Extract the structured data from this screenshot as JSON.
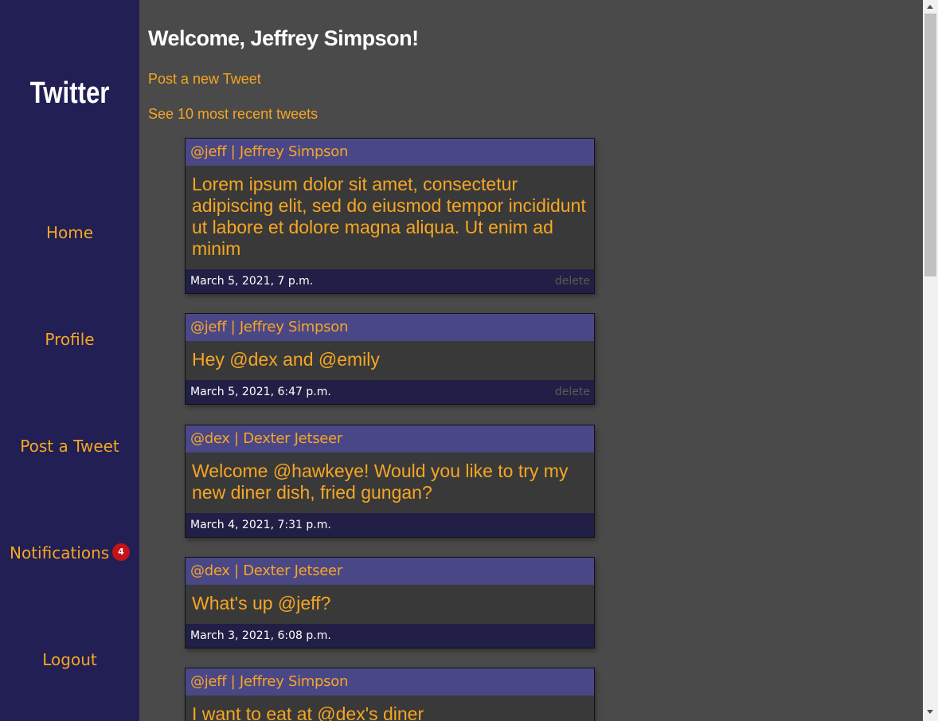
{
  "sidebar": {
    "brand": "Twitter",
    "items": [
      {
        "label": "Home"
      },
      {
        "label": "Profile"
      },
      {
        "label": "Post a Tweet"
      },
      {
        "label": "Notifications",
        "badge": "4"
      },
      {
        "label": "Logout"
      }
    ]
  },
  "main": {
    "welcome": "Welcome, Jeffrey Simpson!",
    "post_link": "Post a new Tweet",
    "recent_link": "See 10 most recent tweets"
  },
  "tweets": [
    {
      "header": "@jeff | Jeffrey Simpson",
      "body": "Lorem ipsum dolor sit amet, consectetur adipiscing elit, sed do eiusmod tempor incididunt ut labore et dolore magna aliqua. Ut enim ad minim",
      "date": "March 5, 2021, 7 p.m.",
      "delete": "delete"
    },
    {
      "header": "@jeff | Jeffrey Simpson",
      "body": "Hey @dex and @emily",
      "date": "March 5, 2021, 6:47 p.m.",
      "delete": "delete"
    },
    {
      "header": "@dex | Dexter Jetseer",
      "body": "Welcome @hawkeye! Would you like to try my new diner dish, fried gungan?",
      "date": "March 4, 2021, 7:31 p.m."
    },
    {
      "header": "@dex | Dexter Jetseer",
      "body": "What's up @jeff?",
      "date": "March 3, 2021, 6:08 p.m."
    },
    {
      "header": "@jeff | Jeffrey Simpson",
      "body": "I want to eat at @dex's diner"
    }
  ],
  "colors": {
    "sidebar_bg": "#211f54",
    "page_bg": "#4a4a4a",
    "accent": "#f5a623",
    "tweet_header_bg": "#4a4787",
    "badge_bg": "#c4141a"
  }
}
